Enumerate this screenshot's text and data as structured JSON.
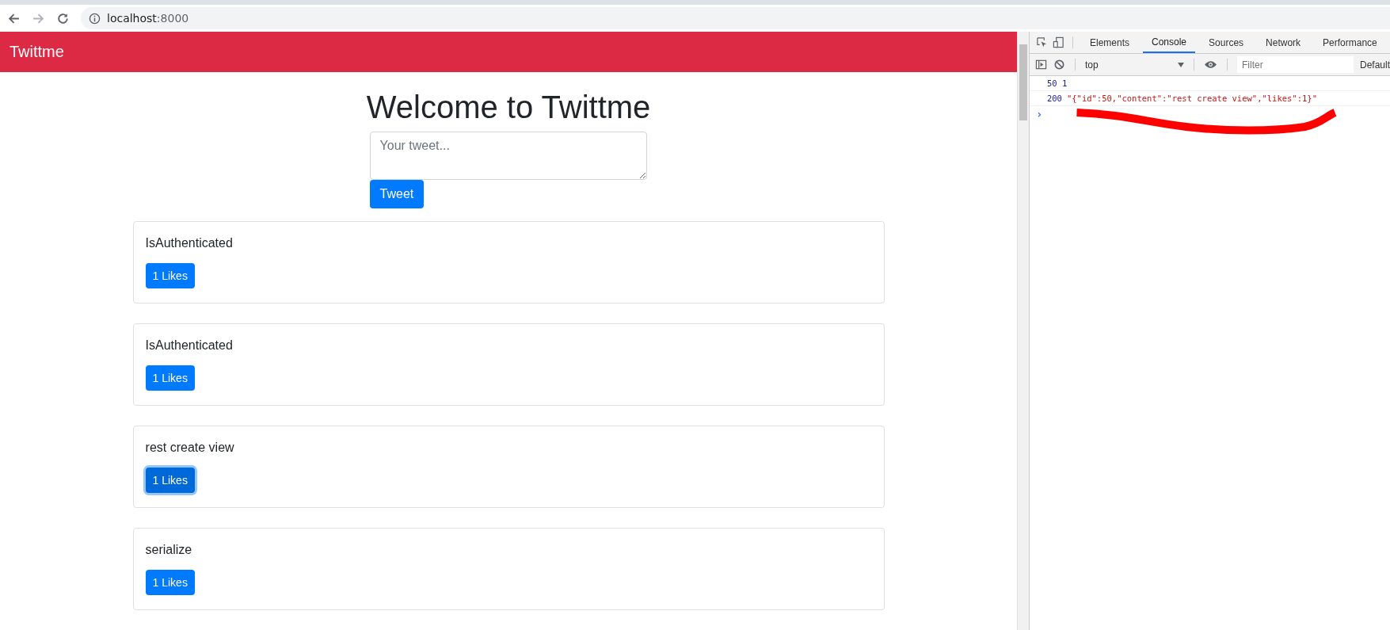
{
  "browser": {
    "url_host": "localhost",
    "url_port": ":8000"
  },
  "navbar": {
    "brand": "Twittme"
  },
  "heading": "Welcome to Twittme",
  "composer": {
    "placeholder": "Your tweet...",
    "button": "Tweet"
  },
  "tweets": [
    {
      "content": "IsAuthenticated",
      "likes": "1 Likes",
      "focused": false
    },
    {
      "content": "IsAuthenticated",
      "likes": "1 Likes",
      "focused": false
    },
    {
      "content": "rest create view",
      "likes": "1 Likes",
      "focused": true
    },
    {
      "content": "serialize",
      "likes": "1 Likes",
      "focused": false
    }
  ],
  "devtools": {
    "tabs": [
      {
        "label": "Elements",
        "selected": false
      },
      {
        "label": "Console",
        "selected": true
      },
      {
        "label": "Sources",
        "selected": false
      },
      {
        "label": "Network",
        "selected": false
      },
      {
        "label": "Performance",
        "selected": false
      }
    ],
    "context": "top",
    "filter_placeholder": "Filter",
    "levels": "Default",
    "console": [
      {
        "kind": "numbers",
        "text": "50 1"
      },
      {
        "kind": "string",
        "number": "200",
        "text": "\"{\"id\":50,\"content\":\"rest create view\",\"likes\":1}\""
      }
    ],
    "prompt": "›"
  }
}
